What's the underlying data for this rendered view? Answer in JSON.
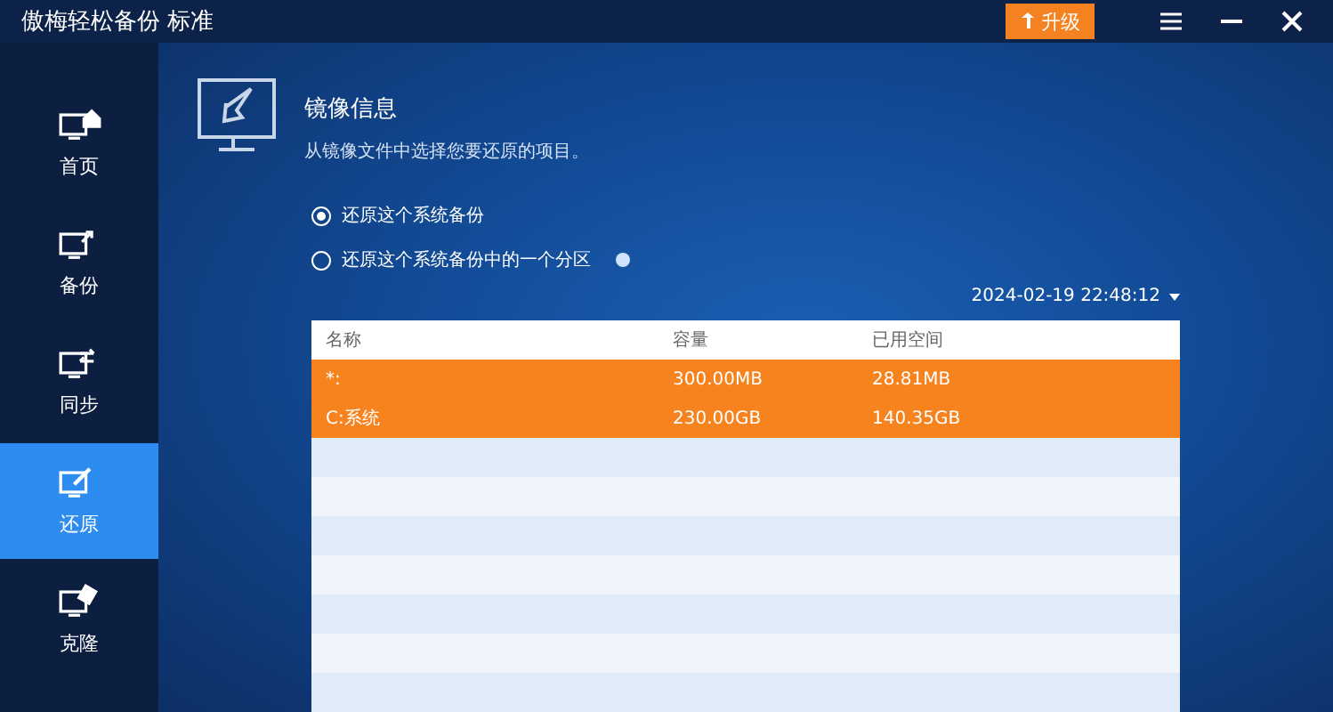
{
  "window": {
    "title": "傲梅轻松备份 标准",
    "upgrade_button": "升级"
  },
  "sidebar": {
    "items": [
      {
        "label": "首页",
        "selected": false
      },
      {
        "label": "备份",
        "selected": false
      },
      {
        "label": "同步",
        "selected": false
      },
      {
        "label": "还原",
        "selected": true
      },
      {
        "label": "克隆",
        "selected": false
      }
    ]
  },
  "header": {
    "title": "镜像信息",
    "subtitle": "从镜像文件中选择您要还原的项目。"
  },
  "options": [
    {
      "label": "还原这个系统备份",
      "selected": true,
      "help": false
    },
    {
      "label": "还原这个系统备份中的一个分区",
      "selected": false,
      "help": true
    }
  ],
  "version_picker": {
    "value": "2024-02-19 22:48:12"
  },
  "table": {
    "columns": [
      "名称",
      "容量",
      "已用空间"
    ],
    "rows": [
      {
        "cells": [
          "*:",
          "300.00MB",
          "28.81MB"
        ],
        "selected": true
      },
      {
        "cells": [
          "C:系统",
          "230.00GB",
          "140.35GB"
        ],
        "selected": true
      }
    ]
  }
}
